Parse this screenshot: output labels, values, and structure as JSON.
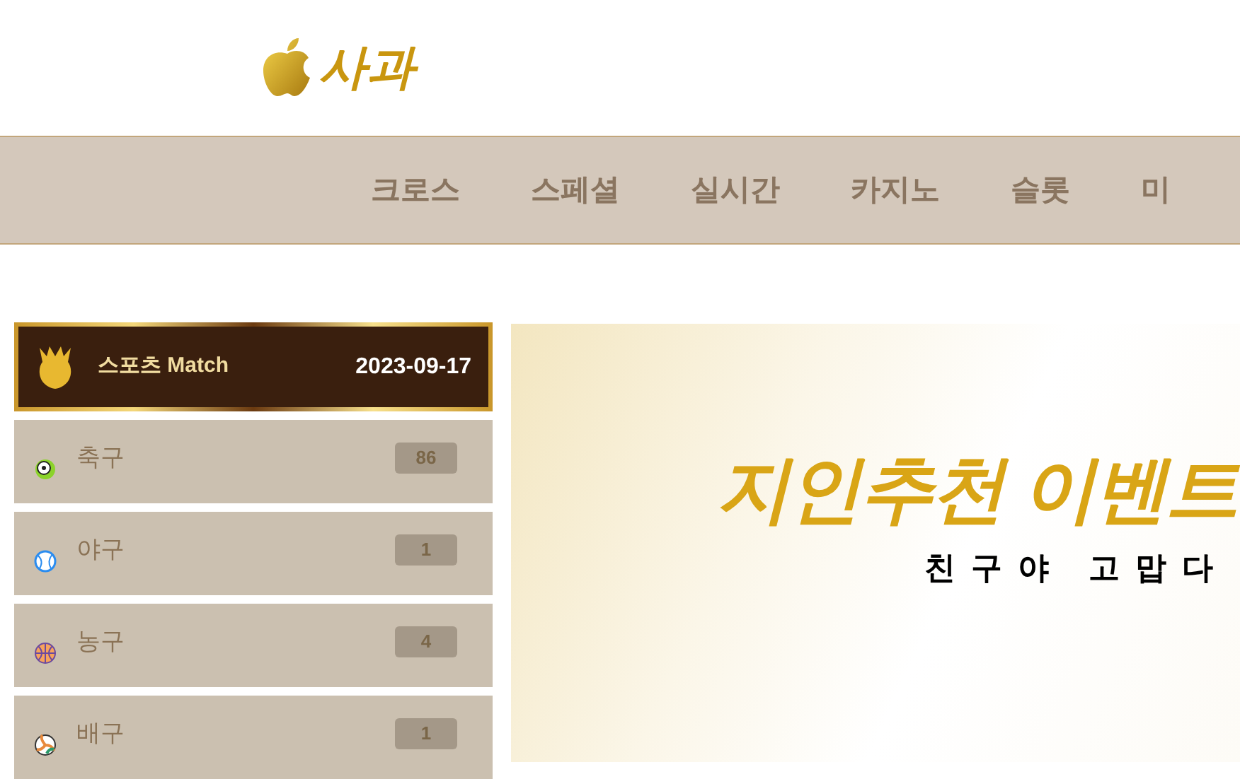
{
  "logo": {
    "text": "사과"
  },
  "nav": [
    "크로스",
    "스페셜",
    "실시간",
    "카지노",
    "슬롯",
    "미"
  ],
  "sports_panel": {
    "title": "스포츠 Match",
    "date": "2023-09-17"
  },
  "sports": [
    {
      "kind": "soccer",
      "name": "축구",
      "count": "86"
    },
    {
      "kind": "baseball",
      "name": "야구",
      "count": "1"
    },
    {
      "kind": "basketball",
      "name": "농구",
      "count": "4"
    },
    {
      "kind": "volleyball",
      "name": "배구",
      "count": "1"
    }
  ],
  "banner": {
    "headline": "지인추천 이벤트",
    "subtitle": "친구야 고맙다"
  }
}
